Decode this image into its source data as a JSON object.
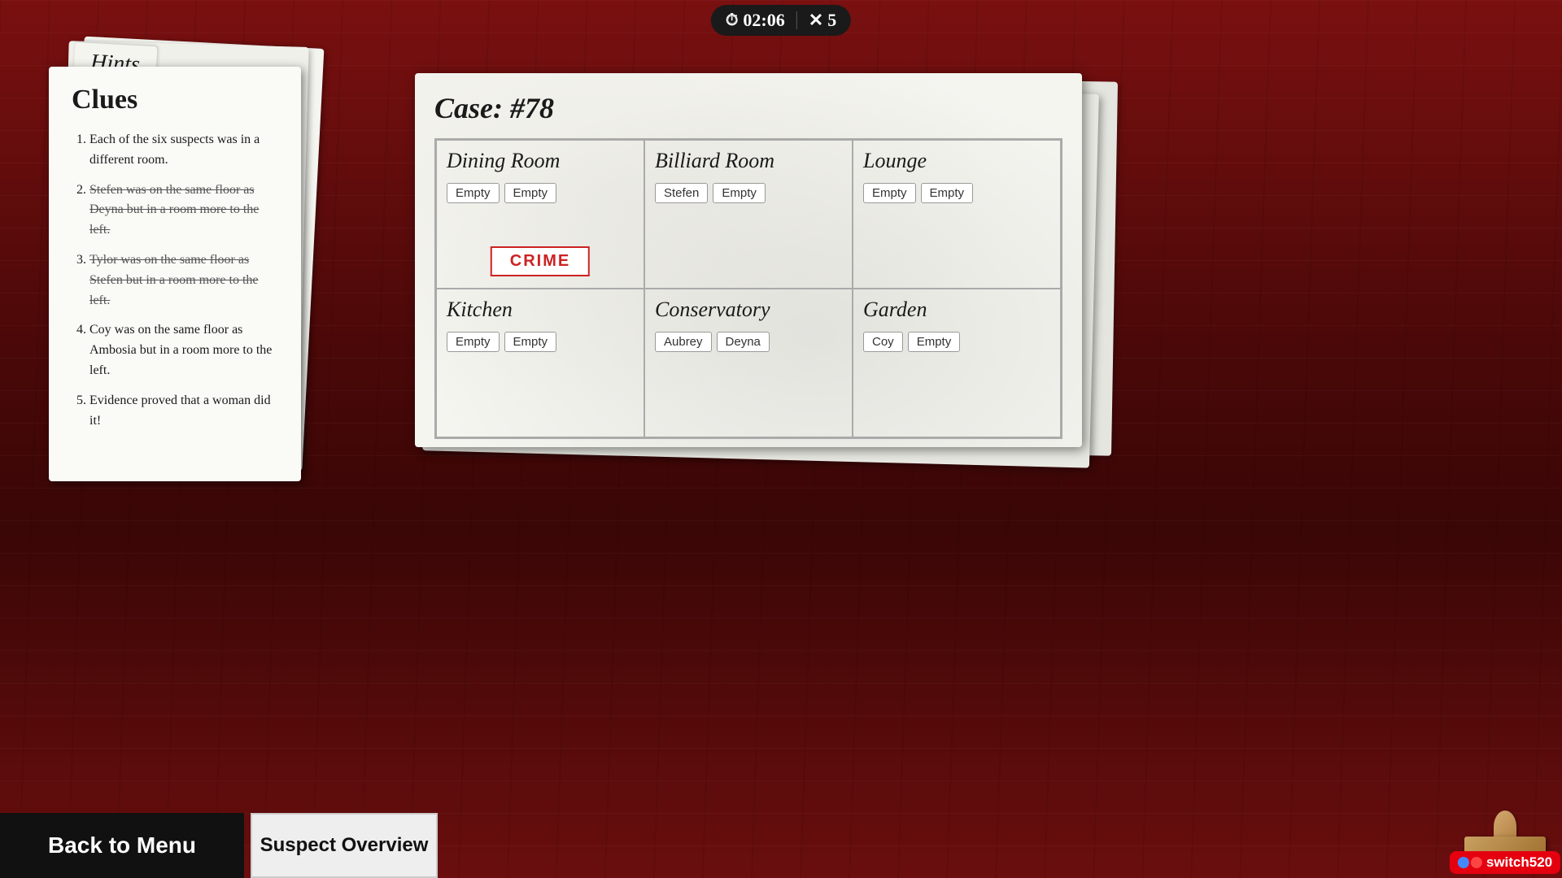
{
  "topbar": {
    "timer": "02:06",
    "lives": "5",
    "clock_symbol": "⏱",
    "x_symbol": "✕"
  },
  "hints": {
    "tab_label": "Hints",
    "card_title": "Clues",
    "clues": [
      {
        "id": 1,
        "text": "Each of the six suspects was in a different room.",
        "struck": false
      },
      {
        "id": 2,
        "text": "Stefen was on the same floor as Deyna but in a room more to the left.",
        "struck": true
      },
      {
        "id": 3,
        "text": "Tylor was on the same floor as Stefen but in a room more to the left.",
        "struck": true
      },
      {
        "id": 4,
        "text": "Coy was on the same floor as Ambosia but in a room more to the left.",
        "struck": false
      },
      {
        "id": 5,
        "text": "Evidence proved that a woman did it!",
        "struck": false
      }
    ]
  },
  "case": {
    "title": "Case: ",
    "number": "#78",
    "rooms": [
      {
        "name": "Dining Room",
        "suspects": [
          "Empty",
          "Empty"
        ],
        "crime": true
      },
      {
        "name": "Billiard Room",
        "suspects": [
          "Stefen",
          "Empty"
        ],
        "crime": false
      },
      {
        "name": "Lounge",
        "suspects": [
          "Empty",
          "Empty"
        ],
        "crime": false
      },
      {
        "name": "Kitchen",
        "suspects": [
          "Empty",
          "Empty"
        ],
        "crime": false
      },
      {
        "name": "Conservatory",
        "suspects": [
          "Aubrey",
          "Deyna"
        ],
        "crime": false
      },
      {
        "name": "Garden",
        "suspects": [
          "Coy",
          "Empty"
        ],
        "crime": false
      }
    ],
    "crime_label": "CRIME"
  },
  "buttons": {
    "back_to_menu": "Back to Menu",
    "suspect_overview": "Suspect Overview"
  },
  "switch": {
    "label": "switch520"
  }
}
